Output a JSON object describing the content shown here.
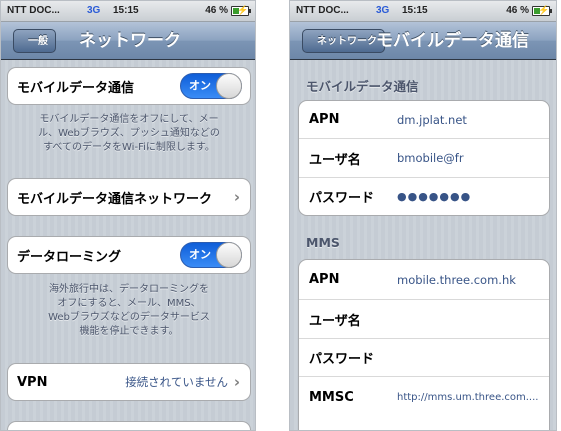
{
  "status": {
    "carrier": "NTT DOC...",
    "network": "3G",
    "time": "15:15",
    "battery": "46 %"
  },
  "left": {
    "back_label": "一般",
    "title": "ネットワーク",
    "mobile_data": {
      "label": "モバイルデータ通信",
      "toggle": "オン",
      "on": true
    },
    "mobile_data_desc": [
      "モバイルデータ通信をオフにして、メー",
      "ル、Webブラウズ、プッシュ通知などの",
      "すべてのデータをWi-Fiに制限します。"
    ],
    "mobile_network_label": "モバイルデータ通信ネットワーク",
    "roaming": {
      "label": "データローミング",
      "toggle": "オン",
      "on": true
    },
    "roaming_desc": [
      "海外旅行中は、データローミングを",
      "オフにすると、メール、MMS、",
      "Webブラウズなどのデータサービス",
      "機能を停止できます。"
    ],
    "vpn": {
      "label": "VPN",
      "value": "接続されていません"
    }
  },
  "right": {
    "back_label": "ネットワーク",
    "title": "モバイルデータ通信",
    "section1_header": "モバイルデータ通信",
    "section1_rows": [
      {
        "label": "APN",
        "value": "dm.jplat.net"
      },
      {
        "label": "ユーザ名",
        "value": "bmobile@fr"
      },
      {
        "label": "パスワード",
        "value": "●●●●●●●"
      }
    ],
    "section2_header": "MMS",
    "section2_rows": [
      {
        "label": "APN",
        "value": "mobile.three.com.hk"
      },
      {
        "label": "ユーザ名",
        "value": ""
      },
      {
        "label": "パスワード",
        "value": ""
      },
      {
        "label": "MMSC",
        "value": "http://mms.um.three.com...."
      }
    ]
  },
  "colors": {
    "toggle_on": "#1a6de6",
    "value_text": "#385487",
    "navbar": "#7c95b5"
  }
}
